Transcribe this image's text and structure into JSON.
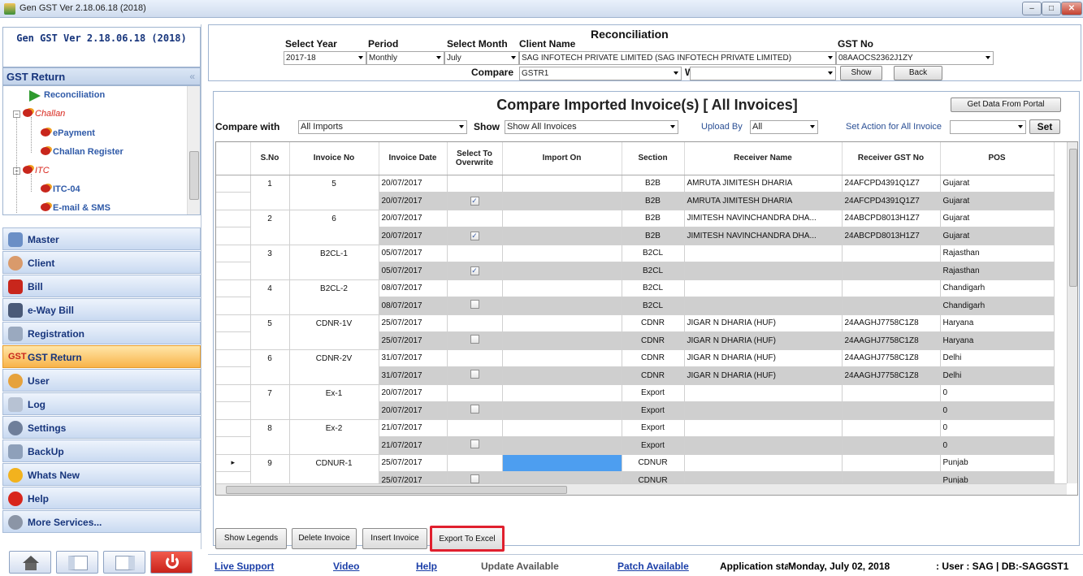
{
  "window": {
    "title": "Gen GST  Ver 2.18.06.18 (2018)",
    "min": "–",
    "max": "□",
    "close": "✕"
  },
  "sidebar": {
    "version": "Gen GST  Ver 2.18.06.18 (2018)",
    "section_title": "GST Return",
    "collapse": "«",
    "tree": [
      "Reconciliation",
      "Challan",
      "ePayment",
      "Challan Register",
      "ITC",
      "ITC-04",
      "E-mail & SMS"
    ],
    "nav": [
      "Master",
      "Client",
      "Bill",
      "e-Way Bill",
      "Registration",
      "GST Return",
      "User",
      "Log",
      "Settings",
      "BackUp",
      "Whats New",
      "Help",
      "More Services..."
    ],
    "active": "GST Return"
  },
  "header": {
    "title": "Reconciliation",
    "year_label": "Select Year",
    "year": "2017-18",
    "period_label": "Period",
    "period": "Monthly",
    "month_label": "Select Month",
    "month": "July",
    "client_label": "Client Name",
    "client": "SAG INFOTECH PRIVATE LIMITED (SAG INFOTECH PRIVATE LIMITED)",
    "gst_label": "GST No",
    "gst": "08AAOCS2362J1ZY",
    "compare_label": "Compare",
    "compare": "GSTR1",
    "with_label": "With",
    "with": "",
    "show_btn": "Show",
    "back_btn": "Back"
  },
  "compare": {
    "title": "Compare Imported Invoice(s) [ All Invoices]",
    "portal_btn": "Get Data From Portal",
    "compare_with_label": "Compare with",
    "compare_with": "All Imports",
    "show_label": "Show",
    "show": "Show All Invoices",
    "upload_label": "Upload By",
    "upload": "All",
    "action_label": "Set Action for All Invoice",
    "action": "",
    "set_btn": "Set"
  },
  "table": {
    "headers": [
      "S.No",
      "Invoice No",
      "Invoice Date",
      "Select To Overwrite",
      "Import On",
      "Section",
      "Receiver Name",
      "Receiver GST No",
      "POS"
    ],
    "rows": [
      {
        "sno": "1",
        "inv": "5",
        "date": "20/07/2017",
        "chk": false,
        "sec": "B2B",
        "name": "AMRUTA JIMITESH DHARIA",
        "gst": "24AFCPD4391Q1Z7",
        "pos": "Gujarat"
      },
      {
        "sno": "",
        "inv": "",
        "date": "20/07/2017",
        "chk": true,
        "sec": "B2B",
        "name": "AMRUTA JIMITESH DHARIA",
        "gst": "24AFCPD4391Q1Z7",
        "pos": "Gujarat"
      },
      {
        "sno": "2",
        "inv": "6",
        "date": "20/07/2017",
        "chk": false,
        "sec": "B2B",
        "name": "JIMITESH NAVINCHANDRA DHA...",
        "gst": "24ABCPD8013H1Z7",
        "pos": "Gujarat"
      },
      {
        "sno": "",
        "inv": "",
        "date": "20/07/2017",
        "chk": true,
        "sec": "B2B",
        "name": "JIMITESH NAVINCHANDRA DHA...",
        "gst": "24ABCPD8013H1Z7",
        "pos": "Gujarat"
      },
      {
        "sno": "3",
        "inv": "B2CL-1",
        "date": "05/07/2017",
        "chk": false,
        "sec": "B2CL",
        "name": "",
        "gst": "",
        "pos": "Rajasthan"
      },
      {
        "sno": "",
        "inv": "",
        "date": "05/07/2017",
        "chk": true,
        "sec": "B2CL",
        "name": "",
        "gst": "",
        "pos": "Rajasthan"
      },
      {
        "sno": "4",
        "inv": "B2CL-2",
        "date": "08/07/2017",
        "chk": false,
        "sec": "B2CL",
        "name": "",
        "gst": "",
        "pos": "Chandigarh"
      },
      {
        "sno": "",
        "inv": "",
        "date": "08/07/2017",
        "chk": "box",
        "sec": "B2CL",
        "name": "",
        "gst": "",
        "pos": "Chandigarh"
      },
      {
        "sno": "5",
        "inv": "CDNR-1V",
        "date": "25/07/2017",
        "chk": false,
        "sec": "CDNR",
        "name": "JIGAR N DHARIA (HUF)",
        "gst": "24AAGHJ7758C1Z8",
        "pos": "Haryana"
      },
      {
        "sno": "",
        "inv": "",
        "date": "25/07/2017",
        "chk": "box",
        "sec": "CDNR",
        "name": "JIGAR N DHARIA (HUF)",
        "gst": "24AAGHJ7758C1Z8",
        "pos": "Haryana"
      },
      {
        "sno": "6",
        "inv": "CDNR-2V",
        "date": "31/07/2017",
        "chk": false,
        "sec": "CDNR",
        "name": "JIGAR N DHARIA (HUF)",
        "gst": "24AAGHJ7758C1Z8",
        "pos": "Delhi"
      },
      {
        "sno": "",
        "inv": "",
        "date": "31/07/2017",
        "chk": "box",
        "sec": "CDNR",
        "name": "JIGAR N DHARIA (HUF)",
        "gst": "24AAGHJ7758C1Z8",
        "pos": "Delhi"
      },
      {
        "sno": "7",
        "inv": "Ex-1",
        "date": "20/07/2017",
        "chk": false,
        "sec": "Export",
        "name": "",
        "gst": "",
        "pos": "0"
      },
      {
        "sno": "",
        "inv": "",
        "date": "20/07/2017",
        "chk": "box",
        "sec": "Export",
        "name": "",
        "gst": "",
        "pos": "0"
      },
      {
        "sno": "8",
        "inv": "Ex-2",
        "date": "21/07/2017",
        "chk": false,
        "sec": "Export",
        "name": "",
        "gst": "",
        "pos": "0"
      },
      {
        "sno": "",
        "inv": "",
        "date": "21/07/2017",
        "chk": "box",
        "sec": "Export",
        "name": "",
        "gst": "",
        "pos": "0"
      },
      {
        "sno": "9",
        "inv": "CDNUR-1",
        "date": "25/07/2017",
        "chk": false,
        "sec": "CDNUR",
        "name": "",
        "gst": "",
        "pos": "Punjab",
        "sel": true
      },
      {
        "sno": "",
        "inv": "",
        "date": "25/07/2017",
        "chk": "box",
        "sec": "CDNUR",
        "name": "",
        "gst": "",
        "pos": "Punjab"
      }
    ]
  },
  "actions": [
    "Show Legends",
    "Delete Invoice",
    "Insert Invoice",
    "Export To Excel"
  ],
  "status": {
    "live": "Live Support",
    "video": "Video",
    "help": "Help",
    "update": "Update Available",
    "patch": "Patch Available",
    "app": "Application sta",
    "date": "Monday, July 02, 2018",
    "user": ": User : SAG | DB:-SAGGST1"
  },
  "colors": {
    "accent": "#17357c",
    "highlight": "#e0202e",
    "selected": "#4d9ef0"
  }
}
